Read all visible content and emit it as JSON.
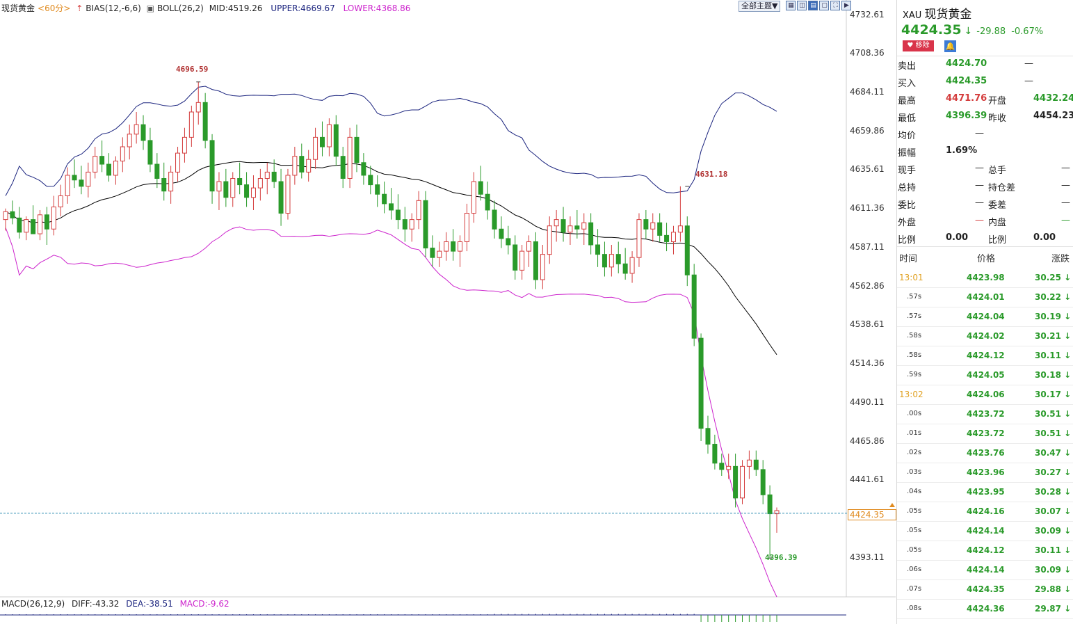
{
  "header": {
    "name": "现货黄金",
    "period": "<60分>",
    "bias": "BIAS(12,-6,6)",
    "boll": "BOLL(26,2)",
    "mid": "MID:4519.26",
    "upper": "UPPER:4669.67",
    "lower": "LOWER:4368.86",
    "theme_button": "全部主题▼"
  },
  "colors": {
    "up": "#d43c3c",
    "down": "#2a9a2a",
    "upper_band": "#1a237e",
    "mid_band": "#000000",
    "lower_band": "#cc22cc",
    "price_line": "#2a8ab0",
    "accent": "#e08a1e"
  },
  "y_axis": {
    "labels": [
      "4732.61",
      "4708.36",
      "4684.11",
      "4659.86",
      "4635.61",
      "4611.36",
      "4587.11",
      "4562.86",
      "4538.61",
      "4514.36",
      "4490.11",
      "4465.86",
      "4441.61",
      "4393.11"
    ],
    "current_price_tag": "4424.35"
  },
  "annotations": {
    "high1": "4696.59",
    "high2": "4631.18",
    "low": "4396.39"
  },
  "macd": {
    "label": "MACD(26,12,9)",
    "diff": "DIFF:-43.32",
    "dea": "DEA:-38.51",
    "macd": "MACD:-9.62"
  },
  "chart_data": {
    "type": "candlestick",
    "ylim": [
      4375,
      4740
    ],
    "candles": [
      {
        "o": 4610,
        "h": 4617,
        "l": 4603,
        "c": 4615
      },
      {
        "o": 4615,
        "h": 4622,
        "l": 4607,
        "c": 4611
      },
      {
        "o": 4611,
        "h": 4618,
        "l": 4598,
        "c": 4602
      },
      {
        "o": 4602,
        "h": 4612,
        "l": 4597,
        "c": 4610
      },
      {
        "o": 4610,
        "h": 4619,
        "l": 4603,
        "c": 4601
      },
      {
        "o": 4601,
        "h": 4616,
        "l": 4597,
        "c": 4613
      },
      {
        "o": 4613,
        "h": 4618,
        "l": 4594,
        "c": 4604
      },
      {
        "o": 4604,
        "h": 4625,
        "l": 4600,
        "c": 4618
      },
      {
        "o": 4618,
        "h": 4632,
        "l": 4612,
        "c": 4625
      },
      {
        "o": 4625,
        "h": 4643,
        "l": 4620,
        "c": 4638
      },
      {
        "o": 4638,
        "h": 4648,
        "l": 4630,
        "c": 4635
      },
      {
        "o": 4635,
        "h": 4644,
        "l": 4626,
        "c": 4631
      },
      {
        "o": 4631,
        "h": 4646,
        "l": 4624,
        "c": 4640
      },
      {
        "o": 4640,
        "h": 4656,
        "l": 4636,
        "c": 4650
      },
      {
        "o": 4650,
        "h": 4660,
        "l": 4640,
        "c": 4645
      },
      {
        "o": 4645,
        "h": 4652,
        "l": 4634,
        "c": 4638
      },
      {
        "o": 4638,
        "h": 4650,
        "l": 4632,
        "c": 4647
      },
      {
        "o": 4647,
        "h": 4662,
        "l": 4640,
        "c": 4656
      },
      {
        "o": 4656,
        "h": 4670,
        "l": 4648,
        "c": 4664
      },
      {
        "o": 4664,
        "h": 4678,
        "l": 4658,
        "c": 4670
      },
      {
        "o": 4670,
        "h": 4676,
        "l": 4654,
        "c": 4660
      },
      {
        "o": 4660,
        "h": 4668,
        "l": 4640,
        "c": 4645
      },
      {
        "o": 4645,
        "h": 4652,
        "l": 4630,
        "c": 4636
      },
      {
        "o": 4636,
        "h": 4646,
        "l": 4622,
        "c": 4628
      },
      {
        "o": 4628,
        "h": 4644,
        "l": 4620,
        "c": 4640
      },
      {
        "o": 4640,
        "h": 4656,
        "l": 4634,
        "c": 4652
      },
      {
        "o": 4652,
        "h": 4668,
        "l": 4646,
        "c": 4662
      },
      {
        "o": 4662,
        "h": 4682,
        "l": 4656,
        "c": 4678
      },
      {
        "o": 4678,
        "h": 4697,
        "l": 4670,
        "c": 4684
      },
      {
        "o": 4684,
        "h": 4690,
        "l": 4655,
        "c": 4660
      },
      {
        "o": 4660,
        "h": 4664,
        "l": 4620,
        "c": 4628
      },
      {
        "o": 4628,
        "h": 4640,
        "l": 4616,
        "c": 4634
      },
      {
        "o": 4634,
        "h": 4642,
        "l": 4618,
        "c": 4624
      },
      {
        "o": 4624,
        "h": 4640,
        "l": 4618,
        "c": 4636
      },
      {
        "o": 4636,
        "h": 4646,
        "l": 4626,
        "c": 4632
      },
      {
        "o": 4632,
        "h": 4640,
        "l": 4618,
        "c": 4624
      },
      {
        "o": 4624,
        "h": 4638,
        "l": 4616,
        "c": 4630
      },
      {
        "o": 4630,
        "h": 4642,
        "l": 4622,
        "c": 4636
      },
      {
        "o": 4636,
        "h": 4646,
        "l": 4626,
        "c": 4640
      },
      {
        "o": 4640,
        "h": 4648,
        "l": 4630,
        "c": 4634
      },
      {
        "o": 4634,
        "h": 4642,
        "l": 4606,
        "c": 4614
      },
      {
        "o": 4614,
        "h": 4642,
        "l": 4610,
        "c": 4638
      },
      {
        "o": 4638,
        "h": 4656,
        "l": 4632,
        "c": 4650
      },
      {
        "o": 4650,
        "h": 4658,
        "l": 4636,
        "c": 4640
      },
      {
        "o": 4640,
        "h": 4654,
        "l": 4634,
        "c": 4648
      },
      {
        "o": 4648,
        "h": 4668,
        "l": 4642,
        "c": 4662
      },
      {
        "o": 4662,
        "h": 4672,
        "l": 4650,
        "c": 4656
      },
      {
        "o": 4656,
        "h": 4674,
        "l": 4650,
        "c": 4670
      },
      {
        "o": 4670,
        "h": 4676,
        "l": 4644,
        "c": 4650
      },
      {
        "o": 4650,
        "h": 4656,
        "l": 4630,
        "c": 4636
      },
      {
        "o": 4636,
        "h": 4668,
        "l": 4630,
        "c": 4662
      },
      {
        "o": 4662,
        "h": 4670,
        "l": 4640,
        "c": 4646
      },
      {
        "o": 4646,
        "h": 4652,
        "l": 4632,
        "c": 4638
      },
      {
        "o": 4638,
        "h": 4644,
        "l": 4626,
        "c": 4632
      },
      {
        "o": 4632,
        "h": 4638,
        "l": 4618,
        "c": 4626
      },
      {
        "o": 4626,
        "h": 4634,
        "l": 4614,
        "c": 4620
      },
      {
        "o": 4620,
        "h": 4630,
        "l": 4610,
        "c": 4616
      },
      {
        "o": 4616,
        "h": 4626,
        "l": 4604,
        "c": 4610
      },
      {
        "o": 4610,
        "h": 4618,
        "l": 4596,
        "c": 4604
      },
      {
        "o": 4604,
        "h": 4614,
        "l": 4596,
        "c": 4610
      },
      {
        "o": 4610,
        "h": 4628,
        "l": 4604,
        "c": 4622
      },
      {
        "o": 4622,
        "h": 4628,
        "l": 4586,
        "c": 4592
      },
      {
        "o": 4592,
        "h": 4600,
        "l": 4580,
        "c": 4586
      },
      {
        "o": 4586,
        "h": 4596,
        "l": 4580,
        "c": 4590
      },
      {
        "o": 4590,
        "h": 4602,
        "l": 4584,
        "c": 4596
      },
      {
        "o": 4596,
        "h": 4604,
        "l": 4584,
        "c": 4590
      },
      {
        "o": 4590,
        "h": 4600,
        "l": 4580,
        "c": 4596
      },
      {
        "o": 4596,
        "h": 4620,
        "l": 4590,
        "c": 4614
      },
      {
        "o": 4614,
        "h": 4640,
        "l": 4608,
        "c": 4634
      },
      {
        "o": 4634,
        "h": 4644,
        "l": 4622,
        "c": 4626
      },
      {
        "o": 4626,
        "h": 4634,
        "l": 4610,
        "c": 4616
      },
      {
        "o": 4616,
        "h": 4622,
        "l": 4598,
        "c": 4604
      },
      {
        "o": 4604,
        "h": 4612,
        "l": 4592,
        "c": 4598
      },
      {
        "o": 4598,
        "h": 4606,
        "l": 4588,
        "c": 4594
      },
      {
        "o": 4594,
        "h": 4600,
        "l": 4572,
        "c": 4578
      },
      {
        "o": 4578,
        "h": 4594,
        "l": 4572,
        "c": 4590
      },
      {
        "o": 4590,
        "h": 4600,
        "l": 4580,
        "c": 4596
      },
      {
        "o": 4596,
        "h": 4602,
        "l": 4566,
        "c": 4572
      },
      {
        "o": 4572,
        "h": 4594,
        "l": 4566,
        "c": 4588
      },
      {
        "o": 4588,
        "h": 4612,
        "l": 4582,
        "c": 4606
      },
      {
        "o": 4606,
        "h": 4616,
        "l": 4596,
        "c": 4610
      },
      {
        "o": 4610,
        "h": 4618,
        "l": 4596,
        "c": 4602
      },
      {
        "o": 4602,
        "h": 4612,
        "l": 4594,
        "c": 4606
      },
      {
        "o": 4606,
        "h": 4616,
        "l": 4598,
        "c": 4604
      },
      {
        "o": 4604,
        "h": 4614,
        "l": 4594,
        "c": 4608
      },
      {
        "o": 4608,
        "h": 4614,
        "l": 4588,
        "c": 4594
      },
      {
        "o": 4594,
        "h": 4604,
        "l": 4580,
        "c": 4588
      },
      {
        "o": 4588,
        "h": 4596,
        "l": 4574,
        "c": 4580
      },
      {
        "o": 4580,
        "h": 4594,
        "l": 4574,
        "c": 4588
      },
      {
        "o": 4588,
        "h": 4596,
        "l": 4576,
        "c": 4582
      },
      {
        "o": 4582,
        "h": 4592,
        "l": 4572,
        "c": 4576
      },
      {
        "o": 4576,
        "h": 4590,
        "l": 4570,
        "c": 4586
      },
      {
        "o": 4586,
        "h": 4614,
        "l": 4580,
        "c": 4610
      },
      {
        "o": 4610,
        "h": 4616,
        "l": 4598,
        "c": 4604
      },
      {
        "o": 4604,
        "h": 4614,
        "l": 4596,
        "c": 4608
      },
      {
        "o": 4608,
        "h": 4614,
        "l": 4596,
        "c": 4600
      },
      {
        "o": 4600,
        "h": 4608,
        "l": 4590,
        "c": 4596
      },
      {
        "o": 4596,
        "h": 4606,
        "l": 4588,
        "c": 4602
      },
      {
        "o": 4602,
        "h": 4631,
        "l": 4596,
        "c": 4606
      },
      {
        "o": 4606,
        "h": 4612,
        "l": 4568,
        "c": 4575
      },
      {
        "o": 4575,
        "h": 4582,
        "l": 4530,
        "c": 4535
      },
      {
        "o": 4535,
        "h": 4538,
        "l": 4470,
        "c": 4478
      },
      {
        "o": 4478,
        "h": 4486,
        "l": 4462,
        "c": 4468
      },
      {
        "o": 4468,
        "h": 4474,
        "l": 4452,
        "c": 4456
      },
      {
        "o": 4456,
        "h": 4462,
        "l": 4448,
        "c": 4452
      },
      {
        "o": 4452,
        "h": 4462,
        "l": 4446,
        "c": 4454
      },
      {
        "o": 4454,
        "h": 4462,
        "l": 4428,
        "c": 4434
      },
      {
        "o": 4434,
        "h": 4458,
        "l": 4430,
        "c": 4454
      },
      {
        "o": 4454,
        "h": 4464,
        "l": 4446,
        "c": 4458
      },
      {
        "o": 4458,
        "h": 4464,
        "l": 4448,
        "c": 4452
      },
      {
        "o": 4452,
        "h": 4458,
        "l": 4430,
        "c": 4436
      },
      {
        "o": 4436,
        "h": 4442,
        "l": 4396,
        "c": 4424
      },
      {
        "o": 4424,
        "h": 4428,
        "l": 4412,
        "c": 4426
      }
    ]
  },
  "panel": {
    "symbol": "XAU",
    "name": "现货黄金",
    "price": "4424.35",
    "arrow": "↓",
    "change": "-29.88",
    "change_pct": "-0.67%",
    "remove_label": "移除",
    "quotes": [
      {
        "l1": "卖出",
        "v1": "4424.70",
        "v1c": "green",
        "l2": "",
        "v2": "—",
        "v2c": ""
      },
      {
        "l1": "买入",
        "v1": "4424.35",
        "v1c": "green",
        "l2": "",
        "v2": "—",
        "v2c": ""
      },
      {
        "l1": "最高",
        "v1": "4471.76",
        "v1c": "red",
        "l2": "开盘",
        "v2": "4432.24",
        "v2c": "green"
      },
      {
        "l1": "最低",
        "v1": "4396.39",
        "v1c": "green",
        "l2": "昨收",
        "v2": "4454.23",
        "v2c": ""
      },
      {
        "l1": "均价",
        "v1": "—",
        "v1c": "",
        "l2": "",
        "v2": "",
        "v2c": ""
      },
      {
        "l1": "振幅",
        "v1": "1.69%",
        "v1c": "",
        "l2": "",
        "v2": "",
        "v2c": ""
      },
      {
        "l1": "现手",
        "v1": "—",
        "v1c": "",
        "l2": "总手",
        "v2": "—",
        "v2c": ""
      },
      {
        "l1": "总持",
        "v1": "—",
        "v1c": "",
        "l2": "持仓差",
        "v2": "—",
        "v2c": ""
      },
      {
        "l1": "委比",
        "v1": "—",
        "v1c": "",
        "l2": "委差",
        "v2": "—",
        "v2c": ""
      },
      {
        "l1": "外盘",
        "v1": "—",
        "v1c": "red",
        "l2": "内盘",
        "v2": "—",
        "v2c": "green"
      },
      {
        "l1": "比例",
        "v1": "0.00",
        "v1c": "",
        "l2": "比例",
        "v2": "0.00",
        "v2c": ""
      }
    ],
    "tick_headers": {
      "time": "时间",
      "price": "价格",
      "change": "涨跌"
    },
    "ticks": [
      {
        "time": "13:01",
        "type": "hl",
        "price": "4423.98",
        "change": "30.25"
      },
      {
        "time": ".57s",
        "type": "sec",
        "price": "4424.01",
        "change": "30.22"
      },
      {
        "time": ".57s",
        "type": "sec",
        "price": "4424.04",
        "change": "30.19"
      },
      {
        "time": ".58s",
        "type": "sec",
        "price": "4424.02",
        "change": "30.21"
      },
      {
        "time": ".58s",
        "type": "sec",
        "price": "4424.12",
        "change": "30.11"
      },
      {
        "time": ".59s",
        "type": "sec",
        "price": "4424.05",
        "change": "30.18"
      },
      {
        "time": "13:02",
        "type": "hl",
        "price": "4424.06",
        "change": "30.17"
      },
      {
        "time": ".00s",
        "type": "sec",
        "price": "4423.72",
        "change": "30.51"
      },
      {
        "time": ".01s",
        "type": "sec",
        "price": "4423.72",
        "change": "30.51"
      },
      {
        "time": ".02s",
        "type": "sec",
        "price": "4423.76",
        "change": "30.47"
      },
      {
        "time": ".03s",
        "type": "sec",
        "price": "4423.96",
        "change": "30.27"
      },
      {
        "time": ".04s",
        "type": "sec",
        "price": "4423.95",
        "change": "30.28"
      },
      {
        "time": ".05s",
        "type": "sec",
        "price": "4424.16",
        "change": "30.07"
      },
      {
        "time": ".05s",
        "type": "sec",
        "price": "4424.14",
        "change": "30.09"
      },
      {
        "time": ".05s",
        "type": "sec",
        "price": "4424.12",
        "change": "30.11"
      },
      {
        "time": ".06s",
        "type": "sec",
        "price": "4424.14",
        "change": "30.09"
      },
      {
        "time": ".07s",
        "type": "sec",
        "price": "4424.35",
        "change": "29.88"
      },
      {
        "time": ".08s",
        "type": "sec",
        "price": "4424.36",
        "change": "29.87"
      }
    ]
  }
}
